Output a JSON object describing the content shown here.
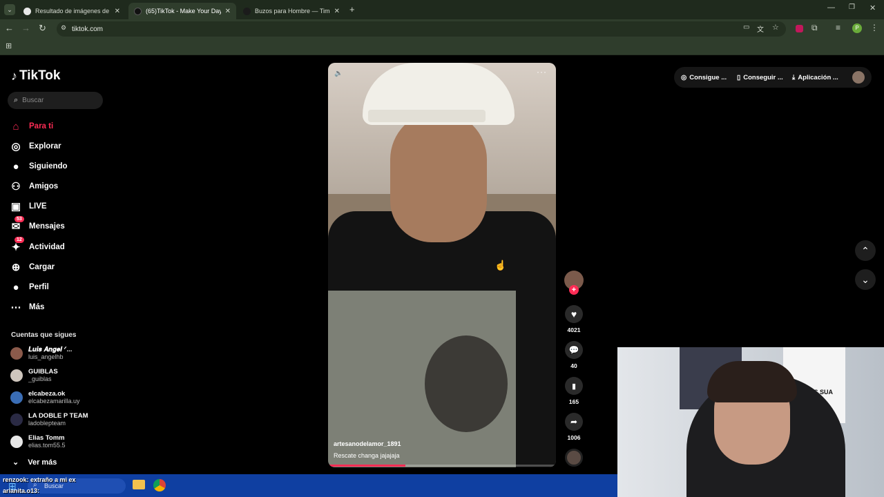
{
  "browser": {
    "tabs": [
      {
        "title": "Resultado de imágenes de Goo",
        "active": false
      },
      {
        "title": "(65)TikTok - Make Your Day",
        "active": true
      },
      {
        "title": "Buzos para Hombre — Timeout",
        "active": false
      }
    ],
    "url": "tiktok.com",
    "profile_initial": "P"
  },
  "tiktok": {
    "logo": "TikTok",
    "search_placeholder": "Buscar",
    "nav": [
      {
        "label": "Para ti",
        "icon": "home-icon",
        "active": true,
        "badge": ""
      },
      {
        "label": "Explorar",
        "icon": "compass-icon",
        "active": false,
        "badge": ""
      },
      {
        "label": "Siguiendo",
        "icon": "following-avatar-icon",
        "active": false,
        "badge": ""
      },
      {
        "label": "Amigos",
        "icon": "friends-icon",
        "active": false,
        "badge": ""
      },
      {
        "label": "LIVE",
        "icon": "live-icon",
        "active": false,
        "badge": ""
      },
      {
        "label": "Mensajes",
        "icon": "messages-icon",
        "active": false,
        "badge": "53"
      },
      {
        "label": "Actividad",
        "icon": "activity-icon",
        "active": false,
        "badge": "12"
      },
      {
        "label": "Cargar",
        "icon": "upload-icon",
        "active": false,
        "badge": ""
      },
      {
        "label": "Perfil",
        "icon": "profile-avatar-icon",
        "active": false,
        "badge": ""
      },
      {
        "label": "Más",
        "icon": "more-icon",
        "active": false,
        "badge": ""
      }
    ],
    "following_header": "Cuentas que sigues",
    "following": [
      {
        "name": "𝑳𝒖𝒊𝒔 𝑨𝒏𝒈𝒆𝒍 ᐟ...",
        "user": "luis_angelhb"
      },
      {
        "name": "GUIBLAS",
        "user": "_guiblas"
      },
      {
        "name": "elcabeza.ok",
        "user": "elcabezamarilla.uy"
      },
      {
        "name": "LA DOBLE P TEAM",
        "user": "ladoblepteam"
      },
      {
        "name": "Elias Tomm",
        "user": "elias.tom55.5"
      }
    ],
    "see_more": "Ver más",
    "top_actions": [
      "Consigue ...",
      "Conseguir ...",
      "Aplicación ..."
    ],
    "video": {
      "username": "artesanodelamor_1891",
      "caption": "Rescate changa jajajaja",
      "progress": 0.34,
      "likes": "4021",
      "comments": "40",
      "saves": "165",
      "shares": "1006"
    }
  },
  "webcam": {
    "poster_text": "LUIS SUA"
  },
  "taskbar": {
    "search": "Buscar",
    "chat": [
      {
        "user": "renzook",
        "text": ": extraño a mi ex"
      },
      {
        "user": "arianita.o13",
        "text": ":"
      }
    ]
  },
  "colors": {
    "accent": "#fe2c55",
    "chrome_bg": "#2f3d2c",
    "taskbar": "#0f3fa1"
  }
}
